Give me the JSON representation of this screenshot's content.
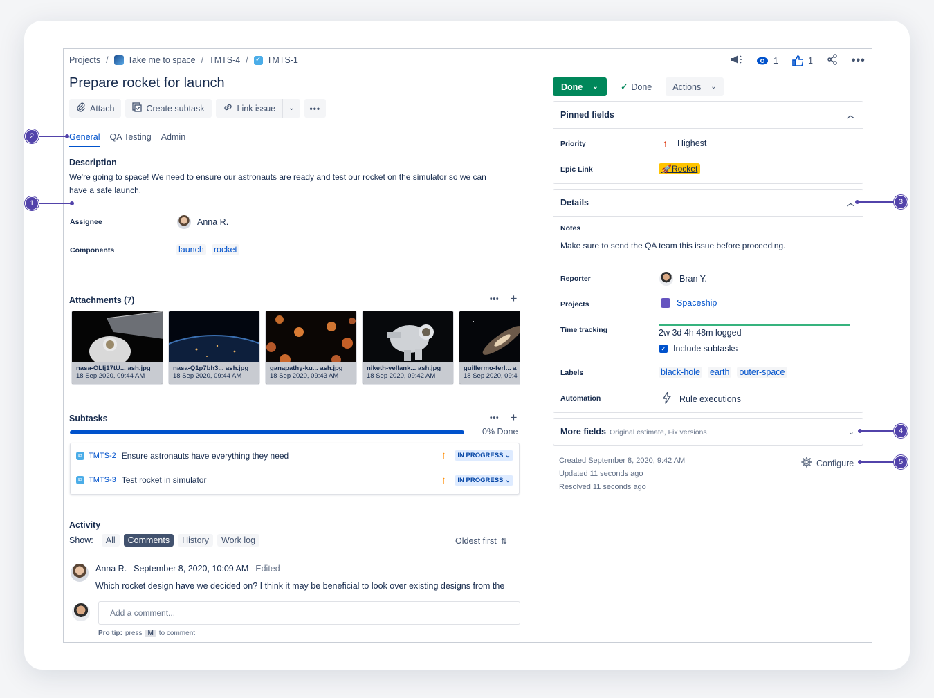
{
  "breadcrumbs": {
    "projects": "Projects",
    "project": "Take me to space",
    "parent": "TMTS-4",
    "issue": "TMTS-1",
    "sep": "/"
  },
  "header_actions": {
    "watchers": "1",
    "votes": "1"
  },
  "issue": {
    "title": "Prepare rocket for launch"
  },
  "toolbar": {
    "attach": "Attach",
    "create_subtask": "Create subtask",
    "link_issue": "Link issue"
  },
  "tabs": [
    "General",
    "QA Testing",
    "Admin"
  ],
  "description": {
    "heading": "Description",
    "text": "We're going to space! We need to ensure our astronauts are ready and test our rocket on the simulator so we can have a safe launch."
  },
  "assignee": {
    "label": "Assignee",
    "name": "Anna R."
  },
  "components": {
    "label": "Components",
    "items": [
      "launch",
      "rocket"
    ]
  },
  "attachments": {
    "heading": "Attachments (7)",
    "items": [
      {
        "name": "nasa-OLlj17tU... ash.jpg",
        "date": "18 Sep 2020, 09:44 AM"
      },
      {
        "name": "nasa-Q1p7bh3... ash.jpg",
        "date": "18 Sep 2020, 09:44 AM"
      },
      {
        "name": "ganapathy-ku... ash.jpg",
        "date": "18 Sep 2020, 09:43 AM"
      },
      {
        "name": "niketh-vellank... ash.jpg",
        "date": "18 Sep 2020, 09:42 AM"
      },
      {
        "name": "guillermo-ferl... a",
        "date": "18 Sep 2020, 09:4"
      }
    ]
  },
  "subtasks": {
    "heading": "Subtasks",
    "done_text": "0% Done",
    "done_fraction": 0,
    "items": [
      {
        "key": "TMTS-2",
        "summary": "Ensure astronauts have everything they need",
        "status": "IN PROGRESS"
      },
      {
        "key": "TMTS-3",
        "summary": "Test rocket in simulator",
        "status": "IN PROGRESS"
      }
    ]
  },
  "activity": {
    "heading": "Activity",
    "show_label": "Show:",
    "filters": [
      "All",
      "Comments",
      "History",
      "Work log"
    ],
    "selected_filter": "Comments",
    "sort": "Oldest first",
    "comment": {
      "author": "Anna R.",
      "date": "September 8, 2020, 10:09 AM",
      "edited": "Edited",
      "text": "Which rocket design have we decided on? I think it may be beneficial to look over existing designs from the"
    },
    "add_comment_placeholder": "Add a comment...",
    "pro_tip_label": "Pro tip:",
    "pro_tip_press": "press",
    "pro_tip_key": "M",
    "pro_tip_suffix": "to comment"
  },
  "status_bar": {
    "status": "Done",
    "resolution": "Done",
    "actions": "Actions"
  },
  "pinned": {
    "heading": "Pinned fields",
    "priority_label": "Priority",
    "priority": "Highest",
    "epic_label": "Epic Link",
    "epic": "Rocket"
  },
  "details": {
    "heading": "Details",
    "notes_label": "Notes",
    "notes": "Make sure to send the QA team this issue before proceeding.",
    "reporter_label": "Reporter",
    "reporter": "Bran Y.",
    "projects_label": "Projects",
    "project": "Spaceship",
    "time_label": "Time tracking",
    "time_logged": "2w 3d 4h 48m logged",
    "include_subtasks": "Include subtasks",
    "labels_label": "Labels",
    "labels": [
      "black-hole",
      "earth",
      "outer-space"
    ],
    "automation_label": "Automation",
    "automation": "Rule executions"
  },
  "more_fields": {
    "heading": "More fields",
    "hint": "Original estimate, Fix versions"
  },
  "meta": {
    "created": "Created September 8, 2020, 9:42 AM",
    "updated": "Updated 11 seconds ago",
    "resolved": "Resolved 11 seconds ago",
    "configure": "Configure"
  },
  "annotations": [
    "1",
    "2",
    "3",
    "4",
    "5"
  ],
  "colors": {
    "accent": "#0052cc",
    "done": "#00875a",
    "annotation": "#5243aa",
    "epic": "#ffc400"
  }
}
